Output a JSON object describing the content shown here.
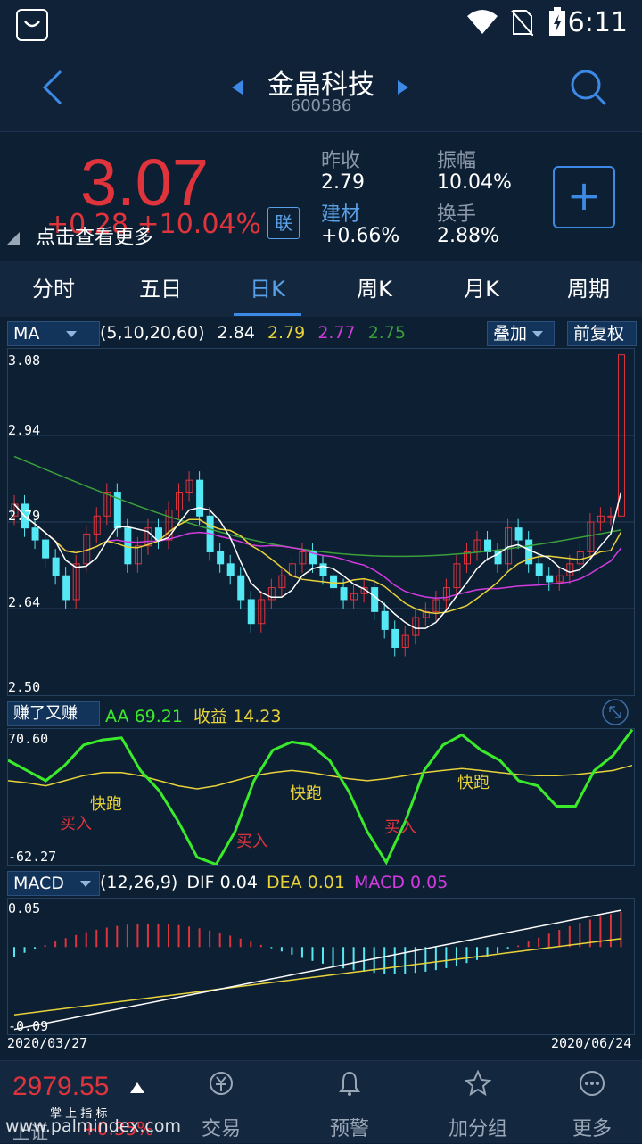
{
  "status_bar": {
    "time": "6:11"
  },
  "header": {
    "stock_name": "金晶科技",
    "stock_code": "600586"
  },
  "quote": {
    "price": "3.07",
    "change": "+0.28  +10.04%",
    "link_tag": "联",
    "tooltip": "点击查看更多",
    "prev_close_label": "昨收",
    "prev_close": "2.79",
    "sector_label": "建材",
    "sector_change": "+0.66%",
    "amplitude_label": "振幅",
    "amplitude": "10.04%",
    "turnover_label": "换手",
    "turnover": "2.88%"
  },
  "tabs": [
    "分时",
    "五日",
    "日K",
    "周K",
    "月K",
    "周期"
  ],
  "active_tab": "日K",
  "ma_panel": {
    "indicator": "MA",
    "params": "(5,10,20,60)",
    "ma5": "2.84",
    "ma10": "2.79",
    "ma20": "2.77",
    "ma60": "2.75",
    "overlay": "叠加",
    "adjust": "前复权",
    "y_ticks": [
      "3.08",
      "2.94",
      "2.79",
      "2.64",
      "2.50"
    ]
  },
  "signal_panel": {
    "indicator": "赚了又赚",
    "aa_label": "AA",
    "aa_value": "69.21",
    "profit_label": "收益",
    "profit_value": "14.23",
    "y_max": "70.60",
    "y_min": "-62.27",
    "buy_label": "买入",
    "sell_label": "快跑"
  },
  "macd_panel": {
    "indicator": "MACD",
    "params": "(12,26,9)",
    "dif_label": "DIF",
    "dif": "0.04",
    "dea_label": "DEA",
    "dea": "0.01",
    "macd_label": "MACD",
    "macd": "0.05",
    "y_max": "0.05",
    "y_min": "-0.09",
    "date_start": "2020/03/27",
    "date_end": "2020/06/24"
  },
  "bottom_bar": {
    "index_value": "2979.55",
    "index_sub": "掌 上 指 标",
    "index_name": "上证",
    "index_change": "+0.35%",
    "watermark": "www.palmindex.com",
    "nav": [
      "交易",
      "预警",
      "加分组",
      "更多"
    ]
  },
  "colors": {
    "up": "#e0343c",
    "down": "#54e8f4",
    "ma5": "#ffffff",
    "ma10": "#e8d23a",
    "ma20": "#d23be0",
    "ma60": "#3aa03a",
    "signal": "#3bea2a",
    "accent": "#3d8ae6"
  }
}
